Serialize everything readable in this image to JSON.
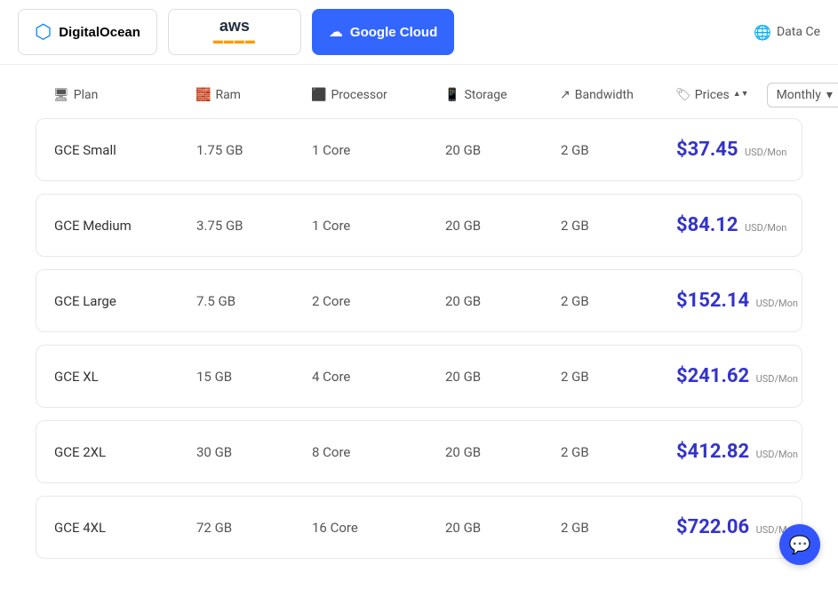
{
  "nav": {
    "providers": [
      {
        "id": "digitalocean",
        "label": "DigitalOcean",
        "active": false
      },
      {
        "id": "aws",
        "label": "aws",
        "active": false
      },
      {
        "id": "googlecloud",
        "label": "Google Cloud",
        "active": true
      }
    ],
    "dataCenter": "Data Ce"
  },
  "table": {
    "columns": [
      {
        "id": "plan",
        "label": "Plan",
        "icon": "🖥"
      },
      {
        "id": "ram",
        "label": "Ram",
        "icon": "🧱"
      },
      {
        "id": "processor",
        "label": "Processor",
        "icon": "🔲"
      },
      {
        "id": "storage",
        "label": "Storage",
        "icon": "📱"
      },
      {
        "id": "bandwidth",
        "label": "Bandwidth",
        "icon": "↗"
      },
      {
        "id": "prices",
        "label": "Prices",
        "icon": "🏷"
      }
    ],
    "billingPeriod": "Monthly",
    "rows": [
      {
        "name": "GCE Small",
        "ram": "1.75 GB",
        "processor": "1 Core",
        "storage": "20 GB",
        "bandwidth": "2 GB",
        "price": "$37.45",
        "unit": "USD/Mon"
      },
      {
        "name": "GCE Medium",
        "ram": "3.75 GB",
        "processor": "1 Core",
        "storage": "20 GB",
        "bandwidth": "2 GB",
        "price": "$84.12",
        "unit": "USD/Mon"
      },
      {
        "name": "GCE Large",
        "ram": "7.5 GB",
        "processor": "2 Core",
        "storage": "20 GB",
        "bandwidth": "2 GB",
        "price": "$152.14",
        "unit": "USD/Mon"
      },
      {
        "name": "GCE XL",
        "ram": "15 GB",
        "processor": "4 Core",
        "storage": "20 GB",
        "bandwidth": "2 GB",
        "price": "$241.62",
        "unit": "USD/Mon"
      },
      {
        "name": "GCE 2XL",
        "ram": "30 GB",
        "processor": "8 Core",
        "storage": "20 GB",
        "bandwidth": "2 GB",
        "price": "$412.82",
        "unit": "USD/Mon"
      },
      {
        "name": "GCE 4XL",
        "ram": "72 GB",
        "processor": "16 Core",
        "storage": "20 GB",
        "bandwidth": "2 GB",
        "price": "$722.06",
        "unit": "USD/Mon"
      }
    ]
  }
}
